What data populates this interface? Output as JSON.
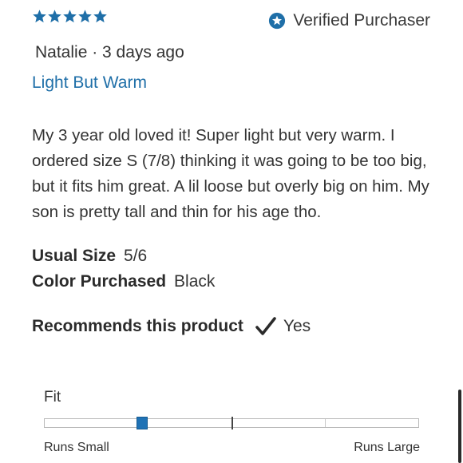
{
  "review": {
    "rating": 5,
    "max_rating": 5,
    "star_icon": "star-icon",
    "star_color": "#1f6fa8",
    "verified_icon": "star-badge-icon",
    "verified_label": "Verified Purchaser",
    "author_date": "Natalie · 3 days ago",
    "title": "Light But Warm",
    "body": "My 3 year old loved it! Super light but very warm. I ordered size S (7/8) thinking it was going to be too big, but it fits him great. A lil loose but overly big on him. My son is pretty tall and thin for his age tho.",
    "usual_size_label": "Usual Size",
    "usual_size_value": "5/6",
    "color_purchased_label": "Color Purchased",
    "color_purchased_value": "Black",
    "recommends_label": "Recommends this product",
    "recommends_icon": "checkmark-icon",
    "recommends_value": "Yes"
  },
  "fit": {
    "label": "Fit",
    "min_label": "Runs Small",
    "max_label": "Runs Large",
    "value_fraction": 0.26,
    "marker_color": "#1f72b5"
  }
}
